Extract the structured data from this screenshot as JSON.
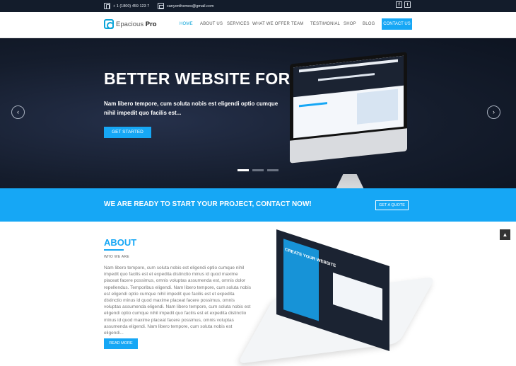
{
  "topbar": {
    "phone": "+ 1 (1800) 459 123 7",
    "email": "canyonthemes@gmail.com",
    "social": [
      "f",
      "t"
    ]
  },
  "header": {
    "logo_main": "Epacious",
    "logo_strong": "Pro",
    "nav": [
      "HOME",
      "ABOUT US",
      "SERVICES",
      "WHAT WE OFFER",
      "TEAM",
      "TESTIMONIAL",
      "SHOP",
      "BLOG"
    ],
    "contact": "CONTACT US"
  },
  "hero": {
    "title": "BETTER WEBSITE FOR.",
    "subtitle": "Nam libero tempore, cum soluta nobis est eligendi optio cumque nihil impedit quo facilis est...",
    "button": "GET STARTED",
    "prev": "‹",
    "next": "›"
  },
  "cta": {
    "text": "WE ARE READY TO START YOUR PROJECT, CONTACT NOW!",
    "button": "GET A QUOTE"
  },
  "about": {
    "title": "ABOUT",
    "subtitle": "WHO WE ARE",
    "body": "Nam libero tempore, cum soluta nobis est eligendi optio cumque nihil impedit quo facilis est et expedita distinctio minus id quod maxime placeat facere possimus, omnis voluptas assumenda est, omnis dolor repellendus. Temporibus eligendi. Nam libero tempore, cum soluta nobis est eligendi optio cumque nihil impedit quo facilis est et expedita distinctio minus id quod maxime placeat facere possimus, omnis voluptas assumenda eligendi. Nam libero tempore, cum soluta nobis est eligendi optio cumque nihil impedit quo facilis est et expedita distinctio minus id quod maxime placeat facere possimus, omnis voluptas assumenda eligendi. Nam libero tempore, cum soluta nobis est eligendi...",
    "button": "READ MORE",
    "tablet_text": "CREATE YOUR WEBSITE"
  },
  "scroll_top": "▲",
  "colors": {
    "accent": "#16a7f5",
    "dark": "#131c2b"
  }
}
